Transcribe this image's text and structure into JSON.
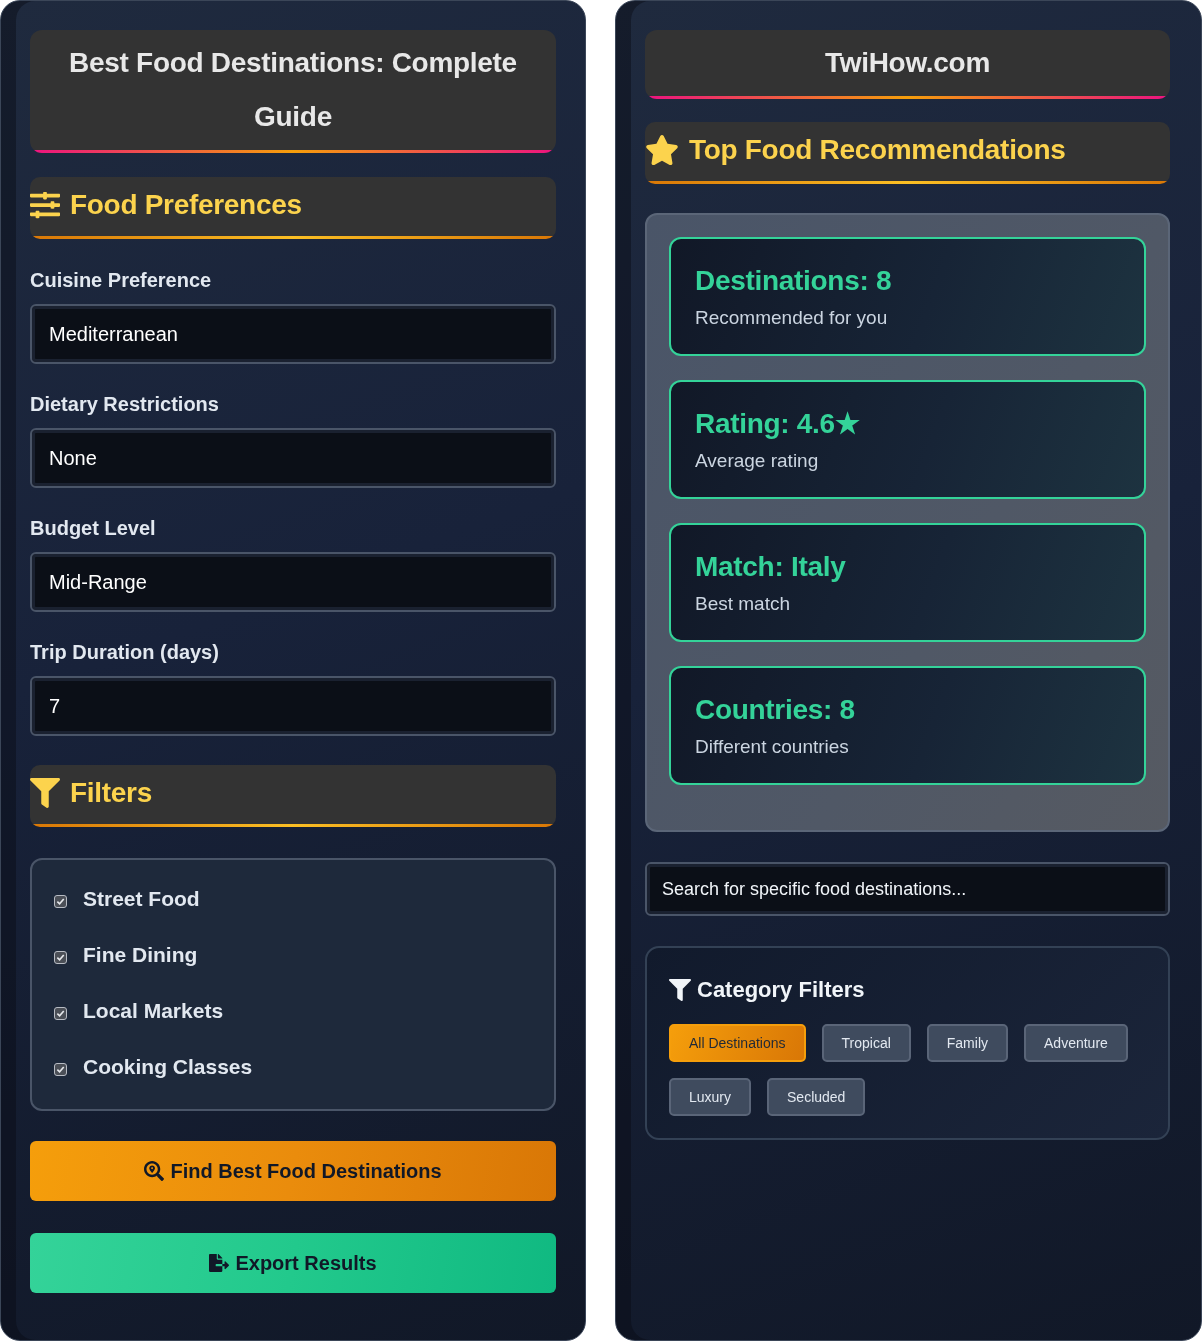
{
  "left_panel": {
    "title": "Best Food Destinations: Complete Guide",
    "preferences": {
      "heading": "Food Preferences",
      "fields": [
        {
          "label": "Cuisine Preference",
          "value": "Mediterranean"
        },
        {
          "label": "Dietary Restrictions",
          "value": "None"
        },
        {
          "label": "Budget Level",
          "value": "Mid-Range"
        },
        {
          "label": "Trip Duration (days)",
          "value": "7"
        }
      ]
    },
    "filters": {
      "heading": "Filters",
      "items": [
        {
          "label": "Street Food",
          "checked": true
        },
        {
          "label": "Fine Dining",
          "checked": true
        },
        {
          "label": "Local Markets",
          "checked": true
        },
        {
          "label": "Cooking Classes",
          "checked": true
        }
      ]
    },
    "buttons": [
      {
        "label": "Find Best Food Destinations",
        "kind": "search"
      },
      {
        "label": "Export Results",
        "kind": "export"
      }
    ]
  },
  "right_panel": {
    "site_title": "TwiHow.com",
    "recommendations": {
      "heading": "Top Food Recommendations",
      "stats": [
        {
          "value": "Destinations: 8",
          "caption": "Recommended for you"
        },
        {
          "value": "Rating: 4.6★",
          "caption": "Average rating"
        },
        {
          "value": "Match: Italy",
          "caption": "Best match"
        },
        {
          "value": "Countries: 8",
          "caption": "Different countries"
        }
      ]
    },
    "search": {
      "placeholder": "Search for specific food destinations..."
    },
    "category_filters": {
      "heading": "Category Filters",
      "chips": [
        {
          "label": "All Destinations",
          "selected": true
        },
        {
          "label": "Tropical",
          "selected": false
        },
        {
          "label": "Family",
          "selected": false
        },
        {
          "label": "Adventure",
          "selected": false
        },
        {
          "label": "Luxury",
          "selected": false
        },
        {
          "label": "Secluded",
          "selected": false
        }
      ]
    }
  }
}
